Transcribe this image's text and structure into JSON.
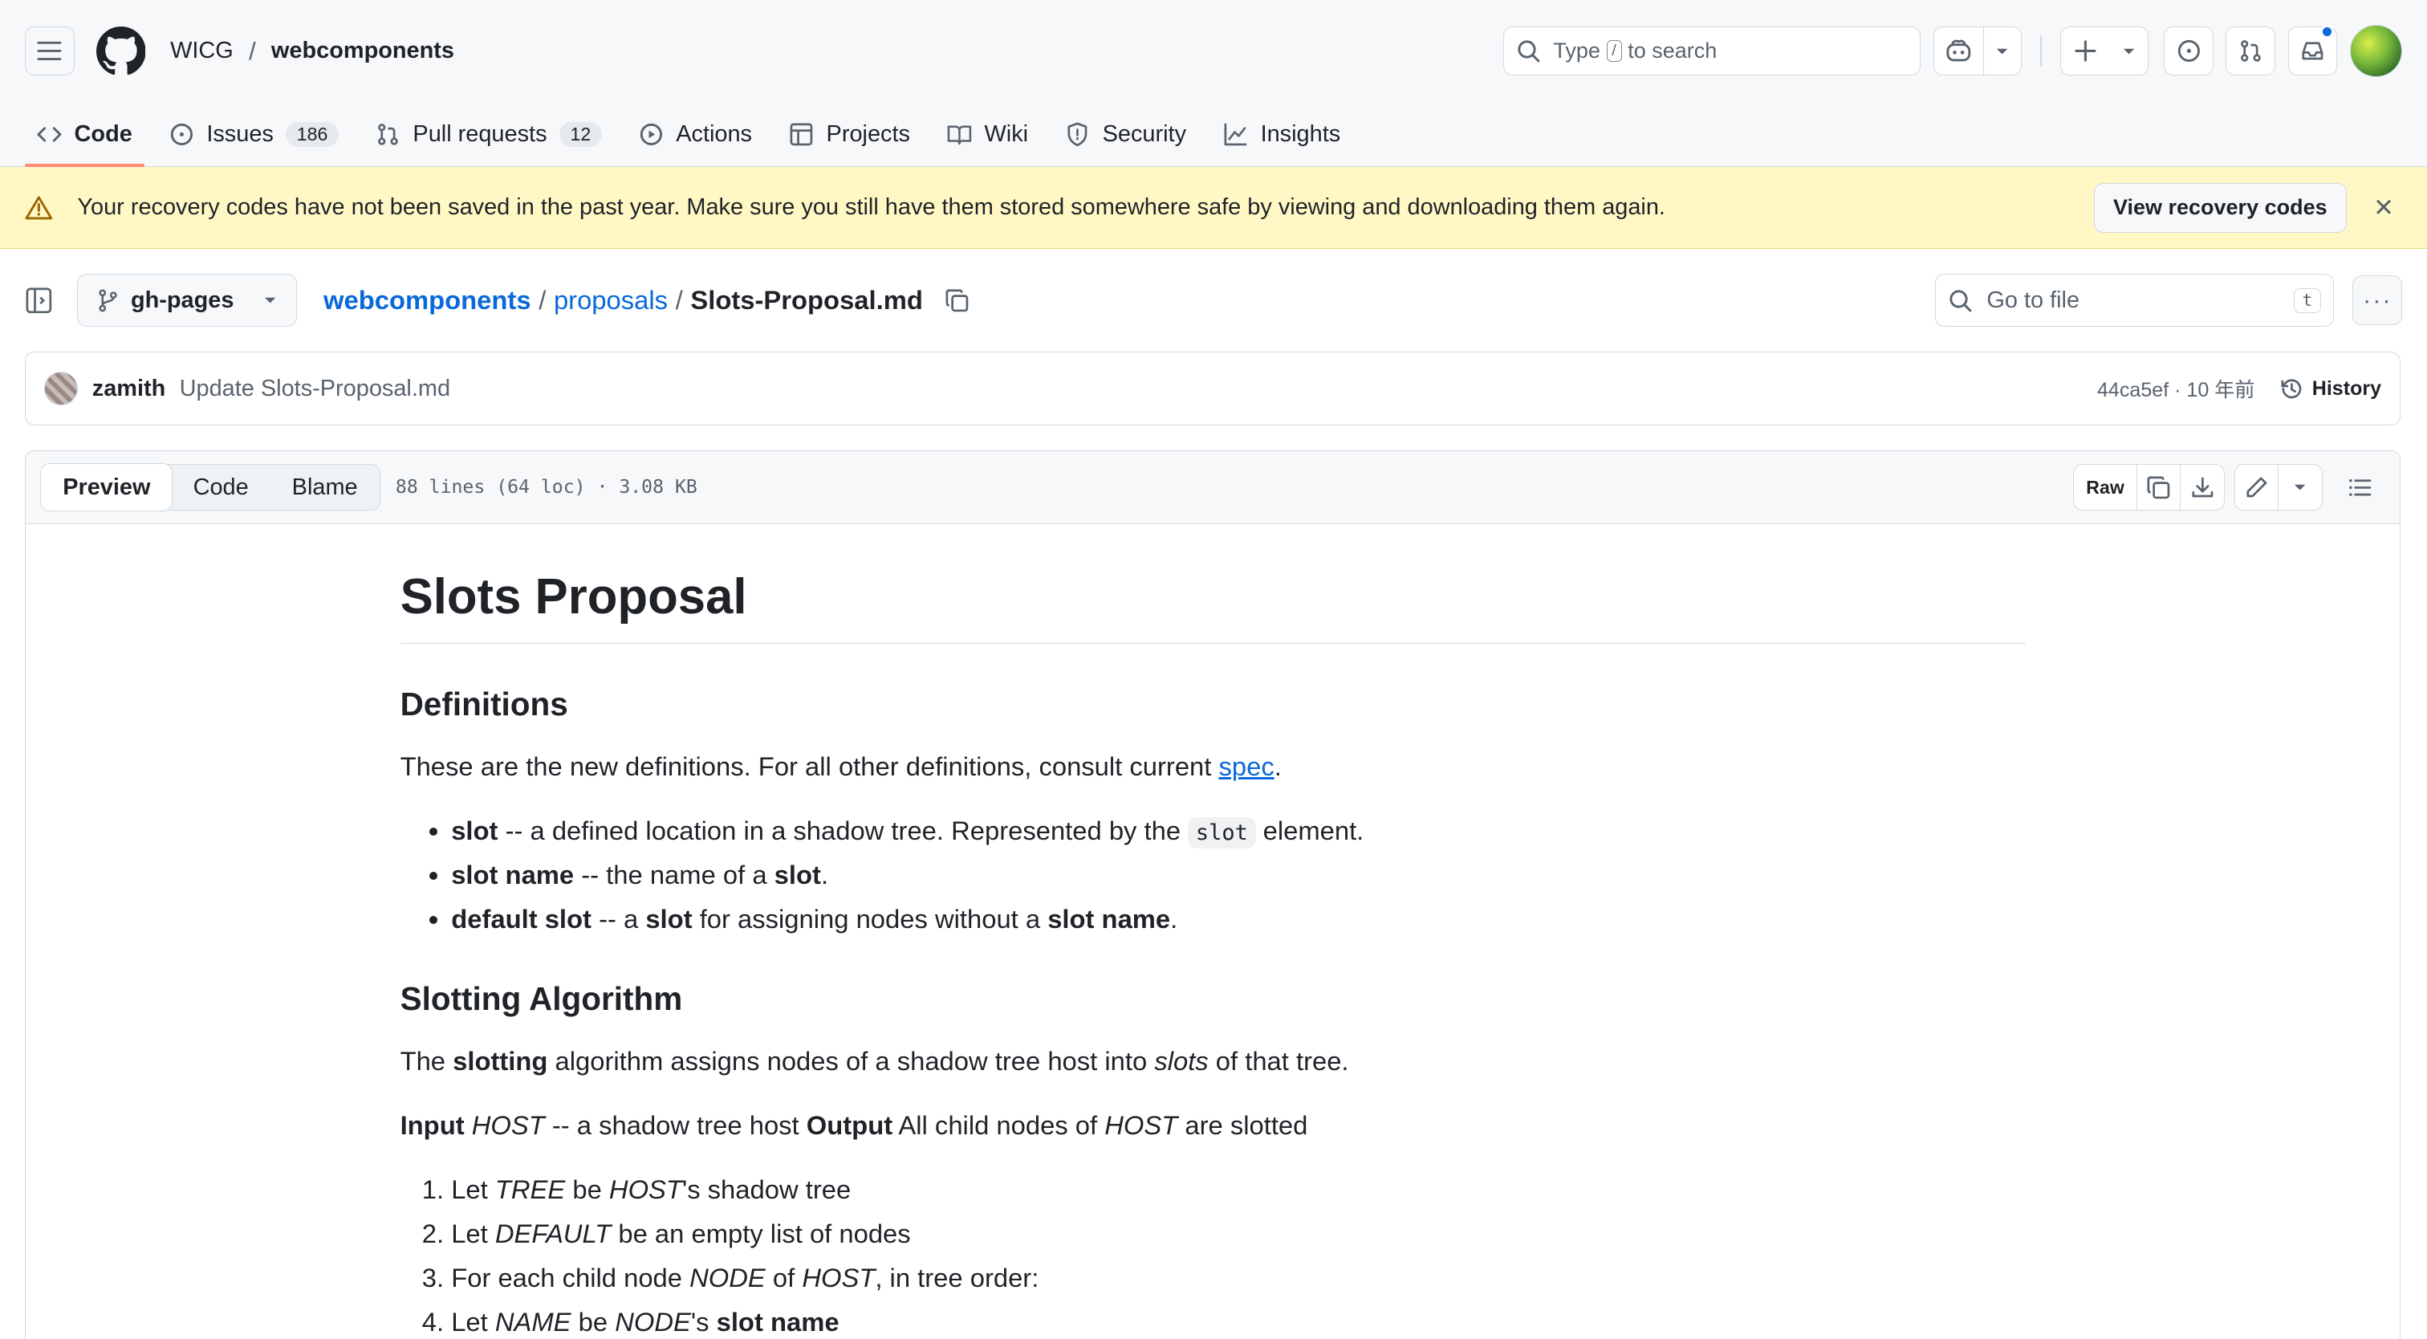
{
  "header": {
    "owner": "WICG",
    "separator": "/",
    "repo": "webcomponents",
    "search": {
      "prefix": "Type",
      "key": "/",
      "suffix": "to search"
    }
  },
  "tabs": [
    {
      "label": "Code",
      "icon": "code-icon"
    },
    {
      "label": "Issues",
      "count": "186",
      "icon": "issue-icon"
    },
    {
      "label": "Pull requests",
      "count": "12",
      "icon": "pull-request-icon"
    },
    {
      "label": "Actions",
      "icon": "play-icon"
    },
    {
      "label": "Projects",
      "icon": "table-icon"
    },
    {
      "label": "Wiki",
      "icon": "book-icon"
    },
    {
      "label": "Security",
      "icon": "shield-icon"
    },
    {
      "label": "Insights",
      "icon": "graph-icon"
    }
  ],
  "banner": {
    "message": "Your recovery codes have not been saved in the past year. Make sure you still have them stored somewhere safe by viewing and downloading them again.",
    "button": "View recovery codes"
  },
  "file_header": {
    "branch": "gh-pages",
    "path_repo": "webcomponents",
    "path_sep": "/",
    "path_dir": "proposals",
    "path_file": "Slots-Proposal.md",
    "goto_placeholder": "Go to file",
    "goto_key": "t"
  },
  "commit": {
    "user": "zamith",
    "message": "Update Slots-Proposal.md",
    "meta": "44ca5ef · 10 年前",
    "history": "History"
  },
  "file_toolbar": {
    "views": [
      "Preview",
      "Code",
      "Blame"
    ],
    "info": "88 lines (64 loc) · 3.08 KB",
    "raw": "Raw"
  },
  "markdown": {
    "title": "Slots Proposal",
    "h_definitions": "Definitions",
    "defs_intro": "These are the new definitions. For all other definitions, consult current ",
    "spec_link": "spec",
    "period": ".",
    "def1": {
      "term": "slot",
      "text1": " -- a defined location in a shadow tree. Represented by the ",
      "code": "slot",
      "text2": " element."
    },
    "def2": {
      "term": "slot name",
      "text1": " -- the name of a ",
      "ref": "slot",
      "text2": "."
    },
    "def3": {
      "term": "default slot",
      "text1": " -- a ",
      "ref1": "slot",
      "text2": " for assigning nodes without a ",
      "ref2": "slot name",
      "text3": "."
    },
    "h_algorithm": "Slotting Algorithm",
    "algo": {
      "t1": "The ",
      "b1": "slotting",
      "t2": " algorithm assigns nodes of a shadow tree host into ",
      "i1": "slots",
      "t3": " of that tree."
    },
    "io": {
      "b1": "Input",
      "i1": "HOST",
      "t1": " -- a shadow tree host ",
      "b2": "Output",
      "t2": " All child nodes of ",
      "i2": "HOST",
      "t3": " are slotted"
    },
    "step1": {
      "t1": "Let ",
      "i1": "TREE",
      "t2": " be ",
      "i2": "HOST",
      "t3": "'s shadow tree"
    },
    "step2": {
      "t1": "Let ",
      "i1": "DEFAULT",
      "t2": " be an empty list of nodes"
    },
    "step3": {
      "t1": "For each child node ",
      "i1": "NODE",
      "t2": " of ",
      "i2": "HOST",
      "t3": ", in tree order:"
    },
    "step4": {
      "t1": "Let ",
      "i1": "NAME",
      "t2": " be ",
      "i2": "NODE",
      "t3": "'s ",
      "b1": "slot name"
    }
  }
}
